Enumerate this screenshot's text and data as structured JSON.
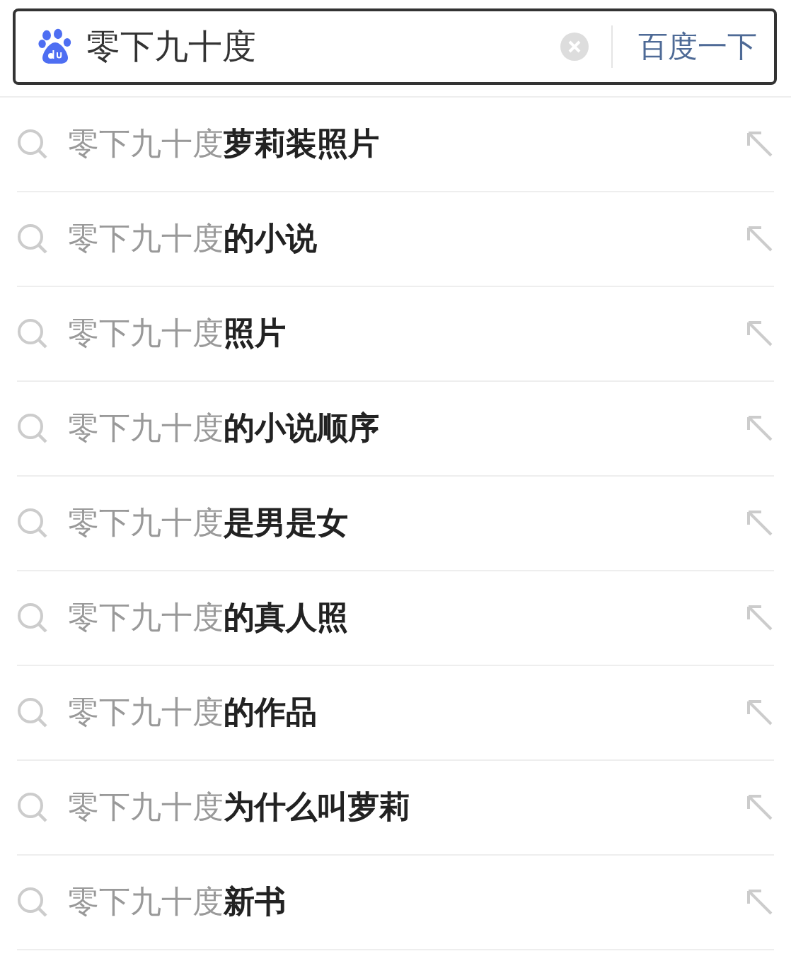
{
  "search": {
    "value": "零下九十度",
    "button": "百度一下"
  },
  "suggestions": [
    {
      "text": "零下九十度**萝莉装照片**"
    },
    {
      "text": "零下九十度**的小说**"
    },
    {
      "text": "零下九十度**照片**"
    },
    {
      "text": "零下九十度**的小说顺序**"
    },
    {
      "text": "零下九十度**是男是女**"
    },
    {
      "text": "零下九十度**的真人照**"
    },
    {
      "text": "零下九十度**的作品**"
    },
    {
      "text": "零下九十度**为什么叫萝莉**"
    },
    {
      "text": "零下九十度**新书**"
    }
  ]
}
